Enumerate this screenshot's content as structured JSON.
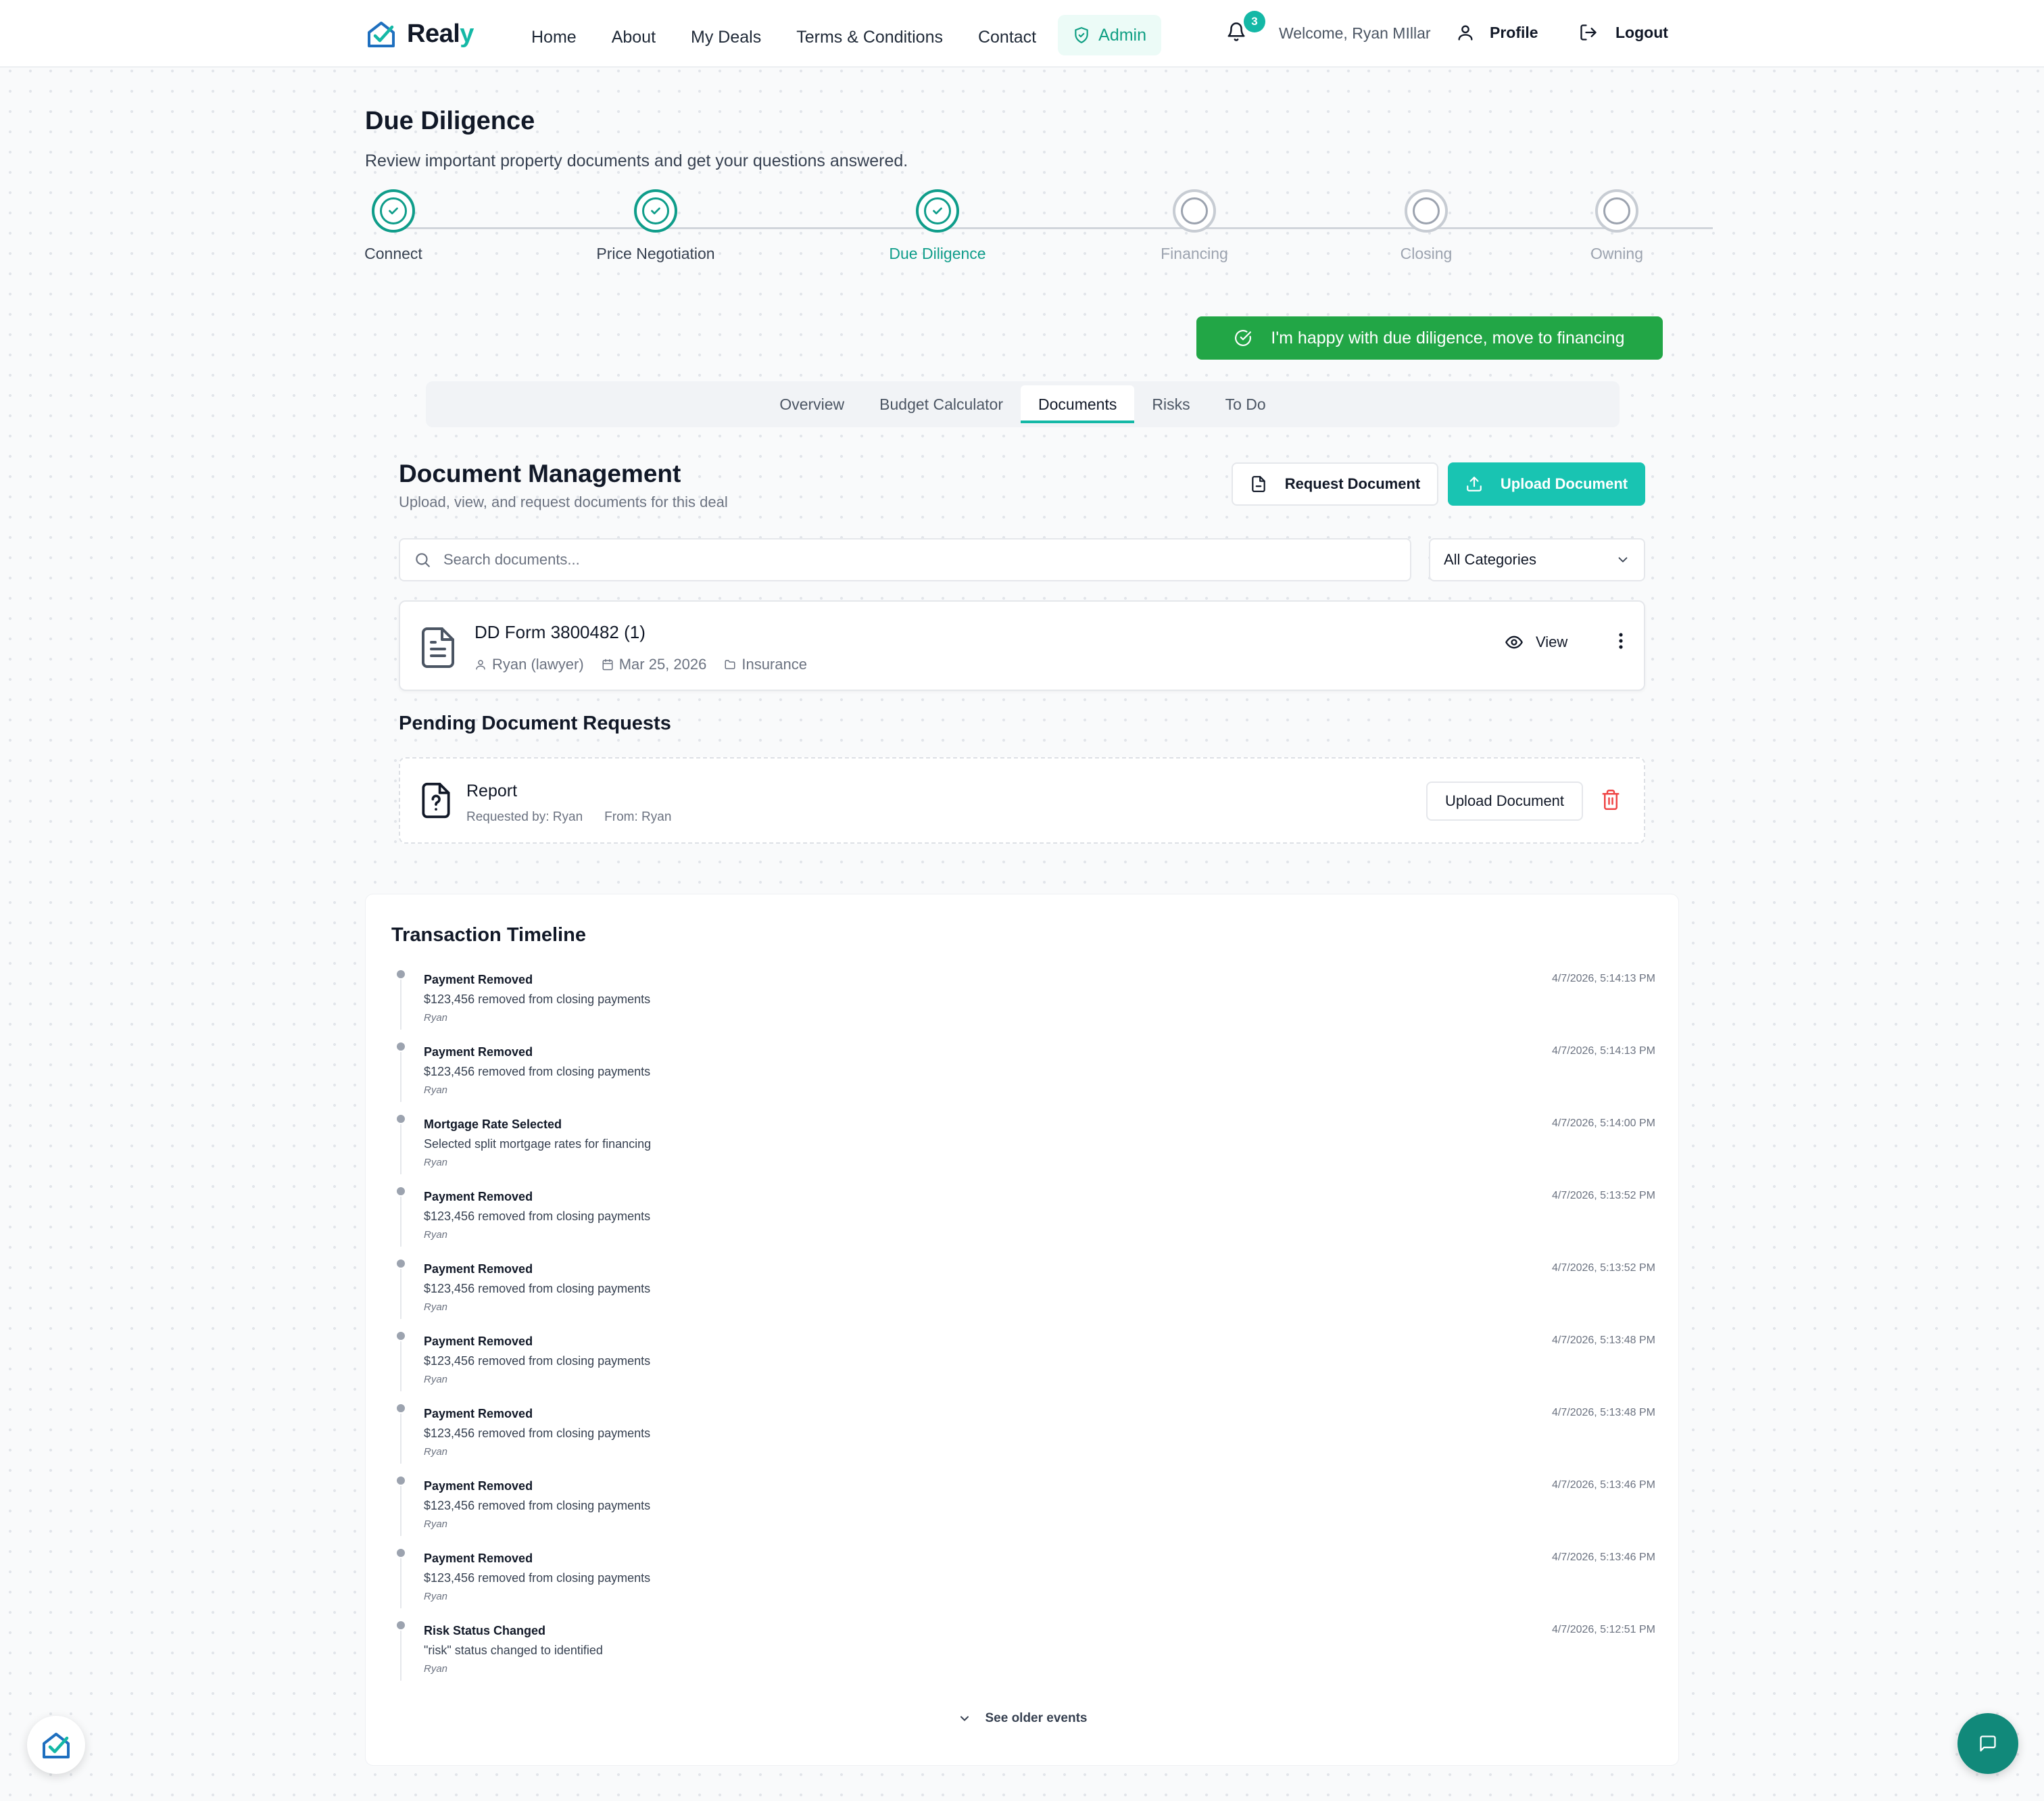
{
  "header": {
    "logo_main": "Real",
    "logo_accent": "y",
    "nav": [
      "Home",
      "About",
      "My Deals",
      "Terms & Conditions",
      "Contact"
    ],
    "admin_label": "Admin",
    "notification_count": "3",
    "welcome": "Welcome, Ryan MIllar",
    "profile_label": "Profile",
    "logout_label": "Logout"
  },
  "page": {
    "title": "Due Diligence",
    "subtitle": "Review important property documents and get your questions answered."
  },
  "stepper": {
    "steps": [
      {
        "label": "Connect",
        "state": "done"
      },
      {
        "label": "Price Negotiation",
        "state": "done"
      },
      {
        "label": "Due Diligence",
        "state": "current"
      },
      {
        "label": "Financing",
        "state": "todo"
      },
      {
        "label": "Closing",
        "state": "todo"
      },
      {
        "label": "Owning",
        "state": "todo"
      }
    ]
  },
  "cta_label": "I'm happy with due diligence, move to financing",
  "tabs": {
    "items": [
      "Overview",
      "Budget Calculator",
      "Documents",
      "Risks",
      "To Do"
    ],
    "active": "Documents"
  },
  "documents": {
    "title": "Document Management",
    "subtitle": "Upload, view, and request documents for this deal",
    "request_label": "Request Document",
    "upload_label": "Upload Document",
    "search_placeholder": "Search documents...",
    "category_selected": "All Categories",
    "items": [
      {
        "name": "DD Form 3800482 (1)",
        "owner": "Ryan (lawyer)",
        "date": "Mar 25, 2026",
        "category": "Insurance",
        "view_label": "View"
      }
    ]
  },
  "pending": {
    "title": "Pending Document Requests",
    "items": [
      {
        "name": "Report",
        "requested_by": "Requested by: Ryan",
        "from": "From: Ryan",
        "upload_label": "Upload Document"
      }
    ]
  },
  "timeline": {
    "title": "Transaction Timeline",
    "events": [
      {
        "title": "Payment Removed",
        "desc": "$123,456 removed from closing payments",
        "user": "Ryan",
        "time": "4/7/2026, 5:14:13 PM"
      },
      {
        "title": "Payment Removed",
        "desc": "$123,456 removed from closing payments",
        "user": "Ryan",
        "time": "4/7/2026, 5:14:13 PM"
      },
      {
        "title": "Mortgage Rate Selected",
        "desc": "Selected split mortgage rates for financing",
        "user": "Ryan",
        "time": "4/7/2026, 5:14:00 PM"
      },
      {
        "title": "Payment Removed",
        "desc": "$123,456 removed from closing payments",
        "user": "Ryan",
        "time": "4/7/2026, 5:13:52 PM"
      },
      {
        "title": "Payment Removed",
        "desc": "$123,456 removed from closing payments",
        "user": "Ryan",
        "time": "4/7/2026, 5:13:52 PM"
      },
      {
        "title": "Payment Removed",
        "desc": "$123,456 removed from closing payments",
        "user": "Ryan",
        "time": "4/7/2026, 5:13:48 PM"
      },
      {
        "title": "Payment Removed",
        "desc": "$123,456 removed from closing payments",
        "user": "Ryan",
        "time": "4/7/2026, 5:13:48 PM"
      },
      {
        "title": "Payment Removed",
        "desc": "$123,456 removed from closing payments",
        "user": "Ryan",
        "time": "4/7/2026, 5:13:46 PM"
      },
      {
        "title": "Payment Removed",
        "desc": "$123,456 removed from closing payments",
        "user": "Ryan",
        "time": "4/7/2026, 5:13:46 PM"
      },
      {
        "title": "Risk Status Changed",
        "desc": "\"risk\" status changed to identified",
        "user": "Ryan",
        "time": "4/7/2026, 5:12:51 PM"
      }
    ],
    "see_older_label": "See older events"
  },
  "colors": {
    "brand_teal": "#14b8a6",
    "stepper_done": "#0f9d8a",
    "cta_green": "#22a646",
    "upload_teal": "#19c4b2",
    "chat_fab": "#11897a",
    "danger": "#ef4444"
  },
  "icons": {
    "logo": "house-check-icon",
    "admin": "shield-check-icon",
    "notifications": "bell-icon",
    "profile": "user-icon",
    "logout": "logout-icon",
    "cta": "check-circle-icon",
    "request": "file-icon",
    "upload": "upload-icon",
    "search": "search-icon",
    "select": "chevron-down-icon",
    "document": "file-text-icon",
    "view": "eye-icon",
    "more": "more-vertical-icon",
    "pending": "file-question-icon",
    "delete": "trash-icon",
    "chat": "message-icon"
  }
}
